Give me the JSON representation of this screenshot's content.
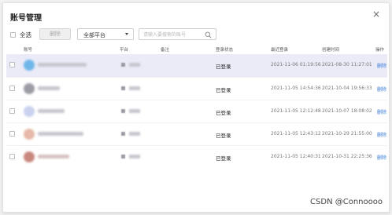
{
  "dialog": {
    "title": "账号管理",
    "close_glyph": "×"
  },
  "toolbar": {
    "select_all_label": "全选",
    "delete_label": "删除",
    "platform_select": {
      "selected": "全部平台"
    },
    "search": {
      "placeholder": "请输入要搜索的账号",
      "value": ""
    }
  },
  "table": {
    "headers": {
      "account": "账号",
      "platform": "平台",
      "remark": "备注",
      "login_status": "登录状态",
      "last_login": "最近登录",
      "created_at": "创建时间",
      "actions": "操作"
    },
    "rows": [
      {
        "status": "已登录",
        "last_login": "2021-11-06 01:19:56",
        "created": "2021-08-30 11:27:01",
        "action": "删除"
      },
      {
        "status": "已登录",
        "last_login": "2021-11-05 14:54:36",
        "created": "2021-10-04 19:56:33",
        "action": "删除"
      },
      {
        "status": "已登录",
        "last_login": "2021-11-05 12:12:48",
        "created": "2021-10-07 18:08:02",
        "action": "删除"
      },
      {
        "status": "已登录",
        "last_login": "2021-11-05 12:43:12",
        "created": "2021-10-29 21:55:00",
        "action": "删除"
      },
      {
        "status": "已登录",
        "last_login": "2021-11-05 12:40:31",
        "created": "2021-10-31 22:25:36",
        "action": "删除"
      }
    ]
  },
  "watermark": "CSDN @Connoooo",
  "colors": {
    "selected_row": "#ebebf8",
    "link": "#3a7bd5"
  }
}
